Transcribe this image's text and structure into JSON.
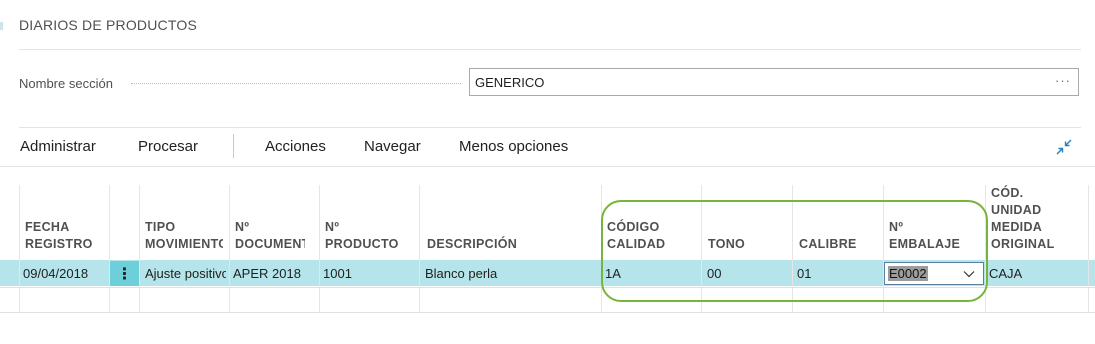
{
  "page": {
    "title": "DIARIOS DE PRODUCTOS"
  },
  "section_field": {
    "label": "Nombre sección",
    "value": "GENERICO",
    "lookup": "···"
  },
  "actions": [
    "Administrar",
    "Procesar",
    "Acciones",
    "Navegar",
    "Menos opciones"
  ],
  "columns": [
    "FECHA\nREGISTRO",
    "TIPO\nMOVIMIENTO",
    "Nº\nDOCUMENTO",
    "Nº\nPRODUCTO",
    "DESCRIPCIÓN",
    "CÓDIGO\nCALIDAD",
    "TONO",
    "CALIBRE",
    "Nº\nEMBALAJE",
    "CÓD.\nUNIDAD\nMEDIDA\nORIGINAL"
  ],
  "rows": [
    {
      "fecha_registro": "09/04/2018",
      "menu": "⋮",
      "tipo_movimiento": "Ajuste positivo",
      "n_documento": "APER 2018",
      "n_producto": "1001",
      "descripcion": "Blanco perla",
      "codigo_calidad": "1A",
      "tono": "00",
      "calibre": "01",
      "n_embalaje": "E0002",
      "cod_unidad_medida": "CAJA"
    }
  ],
  "colors": {
    "row_selected": "#b5e5ea",
    "menu_cell": "#6dcfd9",
    "highlight_outline": "#78b43c"
  },
  "icons": {
    "collapse": "collapse-arrows-icon",
    "dropdown": "chevron-down-icon"
  }
}
